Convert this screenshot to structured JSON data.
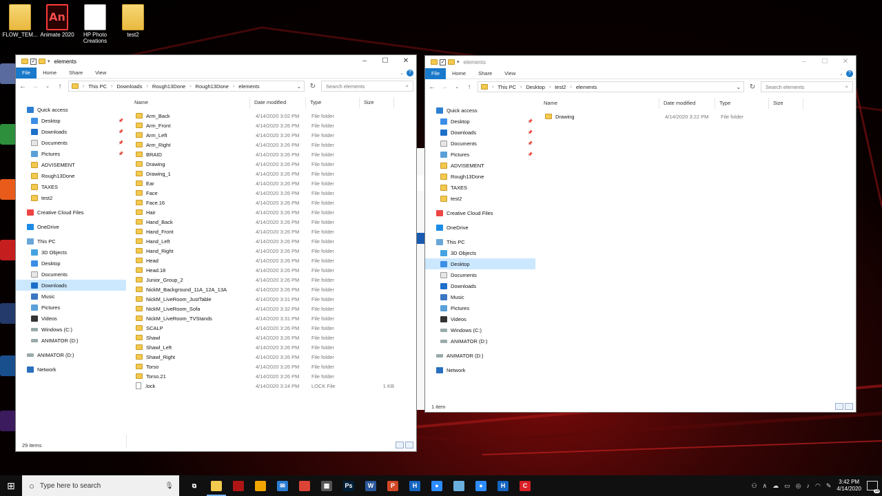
{
  "desktop": {
    "icons": [
      {
        "label": "FLOW_TEM...",
        "icon": "folder-icon"
      },
      {
        "label": "Animate 2020",
        "icon": "animate-icon"
      },
      {
        "label": "HP Photo Creations",
        "icon": "hp-photo-icon"
      },
      {
        "label": "test2",
        "icon": "folder-icon"
      }
    ]
  },
  "left_window": {
    "title": "elements",
    "ribbon": [
      "File",
      "Home",
      "Share",
      "View"
    ],
    "breadcrumb": [
      "This PC",
      "Downloads",
      "Rough13Done",
      "Rough13Done",
      "elements"
    ],
    "search_placeholder": "Search elements",
    "nav": [
      {
        "label": "Quick access",
        "icon": "star-icon",
        "level": 0
      },
      {
        "label": "Desktop",
        "icon": "desktop-icon",
        "level": 1,
        "pinned": true
      },
      {
        "label": "Downloads",
        "icon": "downloads-icon",
        "level": 1,
        "pinned": true
      },
      {
        "label": "Documents",
        "icon": "documents-icon",
        "level": 1,
        "pinned": true
      },
      {
        "label": "Pictures",
        "icon": "pictures-icon",
        "level": 1,
        "pinned": true
      },
      {
        "label": "ADVISEMENT",
        "icon": "folder-icon",
        "level": 1
      },
      {
        "label": "Rough13Done",
        "icon": "folder-icon",
        "level": 1
      },
      {
        "label": "TAXES",
        "icon": "folder-icon",
        "level": 1
      },
      {
        "label": "test2",
        "icon": "folder-icon",
        "level": 1
      },
      {
        "label": "Creative Cloud Files",
        "icon": "creative-cloud-icon",
        "level": 0,
        "gap": true
      },
      {
        "label": "OneDrive",
        "icon": "onedrive-icon",
        "level": 0,
        "gap": true
      },
      {
        "label": "This PC",
        "icon": "pc-icon",
        "level": 0,
        "gap": true
      },
      {
        "label": "3D Objects",
        "icon": "3d-objects-icon",
        "level": 1
      },
      {
        "label": "Desktop",
        "icon": "desktop-icon",
        "level": 1
      },
      {
        "label": "Documents",
        "icon": "documents-icon",
        "level": 1
      },
      {
        "label": "Downloads",
        "icon": "downloads-icon",
        "level": 1,
        "selected": true
      },
      {
        "label": "Music",
        "icon": "music-icon",
        "level": 1
      },
      {
        "label": "Pictures",
        "icon": "pictures-icon",
        "level": 1
      },
      {
        "label": "Videos",
        "icon": "videos-icon",
        "level": 1
      },
      {
        "label": "Windows (C:)",
        "icon": "drive-icon",
        "level": 1
      },
      {
        "label": "ANIMATOR (D:)",
        "icon": "drive-icon",
        "level": 1
      },
      {
        "label": "ANIMATOR (D:)",
        "icon": "drive-icon",
        "level": 0,
        "gap": true
      },
      {
        "label": "Network",
        "icon": "network-icon",
        "level": 0,
        "gap": true
      }
    ],
    "columns": [
      "Name",
      "Date modified",
      "Type",
      "Size"
    ],
    "files": [
      {
        "name": "Arm_Back",
        "date": "4/14/2020 3:02 PM",
        "type": "File folder",
        "size": ""
      },
      {
        "name": "Arm_Front",
        "date": "4/14/2020 3:26 PM",
        "type": "File folder",
        "size": ""
      },
      {
        "name": "Arm_Left",
        "date": "4/14/2020 3:26 PM",
        "type": "File folder",
        "size": ""
      },
      {
        "name": "Arm_Right",
        "date": "4/14/2020 3:26 PM",
        "type": "File folder",
        "size": ""
      },
      {
        "name": "BRAID",
        "date": "4/14/2020 3:26 PM",
        "type": "File folder",
        "size": ""
      },
      {
        "name": "Drawing",
        "date": "4/14/2020 3:26 PM",
        "type": "File folder",
        "size": ""
      },
      {
        "name": "Drawing_1",
        "date": "4/14/2020 3:26 PM",
        "type": "File folder",
        "size": ""
      },
      {
        "name": "Ear",
        "date": "4/14/2020 3:26 PM",
        "type": "File folder",
        "size": ""
      },
      {
        "name": "Face",
        "date": "4/14/2020 3:26 PM",
        "type": "File folder",
        "size": ""
      },
      {
        "name": "Face.16",
        "date": "4/14/2020 3:26 PM",
        "type": "File folder",
        "size": ""
      },
      {
        "name": "Hair",
        "date": "4/14/2020 3:26 PM",
        "type": "File folder",
        "size": ""
      },
      {
        "name": "Hand_Back",
        "date": "4/14/2020 3:26 PM",
        "type": "File folder",
        "size": ""
      },
      {
        "name": "Hand_Front",
        "date": "4/14/2020 3:26 PM",
        "type": "File folder",
        "size": ""
      },
      {
        "name": "Hand_Left",
        "date": "4/14/2020 3:26 PM",
        "type": "File folder",
        "size": ""
      },
      {
        "name": "Hand_Right",
        "date": "4/14/2020 3:26 PM",
        "type": "File folder",
        "size": ""
      },
      {
        "name": "Head",
        "date": "4/14/2020 3:26 PM",
        "type": "File folder",
        "size": ""
      },
      {
        "name": "Head.18",
        "date": "4/14/2020 3:26 PM",
        "type": "File folder",
        "size": ""
      },
      {
        "name": "Junior_Group_2",
        "date": "4/14/2020 3:26 PM",
        "type": "File folder",
        "size": ""
      },
      {
        "name": "NickM_Background_11A_12A_13A",
        "date": "4/14/2020 3:26 PM",
        "type": "File folder",
        "size": ""
      },
      {
        "name": "NickM_LiveRoom_JustTable",
        "date": "4/14/2020 3:31 PM",
        "type": "File folder",
        "size": ""
      },
      {
        "name": "NickM_LiveRoom_Sofa",
        "date": "4/14/2020 3:32 PM",
        "type": "File folder",
        "size": ""
      },
      {
        "name": "NickM_LiveRoom_TVStands",
        "date": "4/14/2020 3:31 PM",
        "type": "File folder",
        "size": ""
      },
      {
        "name": "SCALP",
        "date": "4/14/2020 3:26 PM",
        "type": "File folder",
        "size": ""
      },
      {
        "name": "Shawl",
        "date": "4/14/2020 3:26 PM",
        "type": "File folder",
        "size": ""
      },
      {
        "name": "Shawl_Left",
        "date": "4/14/2020 3:26 PM",
        "type": "File folder",
        "size": ""
      },
      {
        "name": "Shawl_Right",
        "date": "4/14/2020 3:26 PM",
        "type": "File folder",
        "size": ""
      },
      {
        "name": "Torso",
        "date": "4/14/2020 3:26 PM",
        "type": "File folder",
        "size": ""
      },
      {
        "name": "Torso.21",
        "date": "4/14/2020 3:26 PM",
        "type": "File folder",
        "size": ""
      },
      {
        "name": ".lock",
        "date": "4/14/2020 3:24 PM",
        "type": "LOCK File",
        "size": "1 KB",
        "file": true
      }
    ],
    "status": "29 items"
  },
  "right_window": {
    "title": "elements",
    "ribbon": [
      "File",
      "Home",
      "Share",
      "View"
    ],
    "breadcrumb": [
      "This PC",
      "Desktop",
      "test2",
      "elements"
    ],
    "search_placeholder": "Search elements",
    "nav": [
      {
        "label": "Quick access",
        "icon": "star-icon",
        "level": 0
      },
      {
        "label": "Desktop",
        "icon": "desktop-icon",
        "level": 1,
        "pinned": true
      },
      {
        "label": "Downloads",
        "icon": "downloads-icon",
        "level": 1,
        "pinned": true
      },
      {
        "label": "Documents",
        "icon": "documents-icon",
        "level": 1,
        "pinned": true
      },
      {
        "label": "Pictures",
        "icon": "pictures-icon",
        "level": 1,
        "pinned": true
      },
      {
        "label": "ADVISEMENT",
        "icon": "folder-icon",
        "level": 1
      },
      {
        "label": "Rough13Done",
        "icon": "folder-icon",
        "level": 1
      },
      {
        "label": "TAXES",
        "icon": "folder-icon",
        "level": 1
      },
      {
        "label": "test2",
        "icon": "folder-icon",
        "level": 1
      },
      {
        "label": "Creative Cloud Files",
        "icon": "creative-cloud-icon",
        "level": 0,
        "gap": true
      },
      {
        "label": "OneDrive",
        "icon": "onedrive-icon",
        "level": 0,
        "gap": true
      },
      {
        "label": "This PC",
        "icon": "pc-icon",
        "level": 0,
        "gap": true
      },
      {
        "label": "3D Objects",
        "icon": "3d-objects-icon",
        "level": 1
      },
      {
        "label": "Desktop",
        "icon": "desktop-icon",
        "level": 1,
        "selected": true
      },
      {
        "label": "Documents",
        "icon": "documents-icon",
        "level": 1
      },
      {
        "label": "Downloads",
        "icon": "downloads-icon",
        "level": 1
      },
      {
        "label": "Music",
        "icon": "music-icon",
        "level": 1
      },
      {
        "label": "Pictures",
        "icon": "pictures-icon",
        "level": 1
      },
      {
        "label": "Videos",
        "icon": "videos-icon",
        "level": 1
      },
      {
        "label": "Windows (C:)",
        "icon": "drive-icon",
        "level": 1
      },
      {
        "label": "ANIMATOR (D:)",
        "icon": "drive-icon",
        "level": 1
      },
      {
        "label": "ANIMATOR (D:)",
        "icon": "drive-icon",
        "level": 0,
        "gap": true
      },
      {
        "label": "Network",
        "icon": "network-icon",
        "level": 0,
        "gap": true
      }
    ],
    "columns": [
      "Name",
      "Date modified",
      "Type",
      "Size"
    ],
    "files": [
      {
        "name": "Drawing",
        "date": "4/14/2020 3:22 PM",
        "type": "File folder",
        "size": ""
      }
    ],
    "status": "1 item"
  },
  "taskbar": {
    "search_placeholder": "Type here to search",
    "apps": [
      {
        "icon": "task-view-icon",
        "color": "#101010",
        "glyph": "⧉"
      },
      {
        "icon": "file-explorer-icon",
        "color": "#f3c94e",
        "glyph": "",
        "active": true
      },
      {
        "icon": "red-app-icon",
        "color": "#b01515",
        "glyph": ""
      },
      {
        "icon": "store-icon",
        "color": "#f0a500",
        "glyph": ""
      },
      {
        "icon": "mail-icon",
        "color": "#2b7cd3",
        "glyph": "✉"
      },
      {
        "icon": "chrome-icon",
        "color": "#db4437",
        "glyph": ""
      },
      {
        "icon": "calculator-icon",
        "color": "#555555",
        "glyph": "▦"
      },
      {
        "icon": "photoshop-icon",
        "color": "#001e36",
        "glyph": "Ps"
      },
      {
        "icon": "word-icon",
        "color": "#2b579a",
        "glyph": "W"
      },
      {
        "icon": "powerpoint-icon",
        "color": "#d24726",
        "glyph": "P"
      },
      {
        "icon": "harmony-icon",
        "color": "#1565c0",
        "glyph": "H"
      },
      {
        "icon": "zoom-icon",
        "color": "#2d8cff",
        "glyph": "●"
      },
      {
        "icon": "storyboard-icon",
        "color": "#6ab0de",
        "glyph": ""
      },
      {
        "icon": "zoom-icon-2",
        "color": "#2d8cff",
        "glyph": "●"
      },
      {
        "icon": "harmony-icon-2",
        "color": "#1565c0",
        "glyph": "H"
      },
      {
        "icon": "creative-cloud-app-icon",
        "color": "#da1f26",
        "glyph": "C"
      }
    ],
    "time": "3:42 PM",
    "date": "4/14/2020",
    "notification_count": "19"
  }
}
